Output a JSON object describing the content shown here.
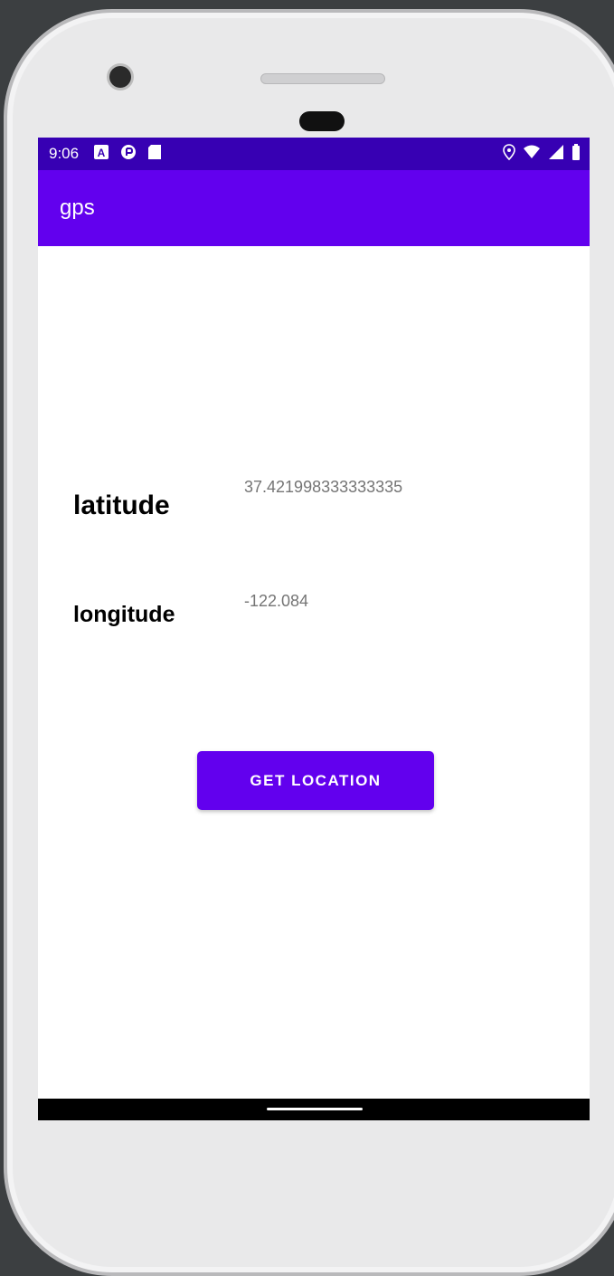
{
  "status_bar": {
    "time": "9:06",
    "left_icons": [
      "a-icon",
      "sync-icon",
      "sd-card-icon"
    ],
    "right_icons": [
      "location-icon",
      "wifi-icon",
      "signal-icon",
      "battery-icon"
    ]
  },
  "app_bar": {
    "title": "gps"
  },
  "main": {
    "latitude_label": "latitude",
    "latitude_value": "37.421998333333335",
    "longitude_label": "longitude",
    "longitude_value": "-122.084",
    "button_label": "GET LOCATION"
  },
  "colors": {
    "status_bar": "#3700b3",
    "primary": "#6200ee",
    "value_text": "#757575"
  }
}
